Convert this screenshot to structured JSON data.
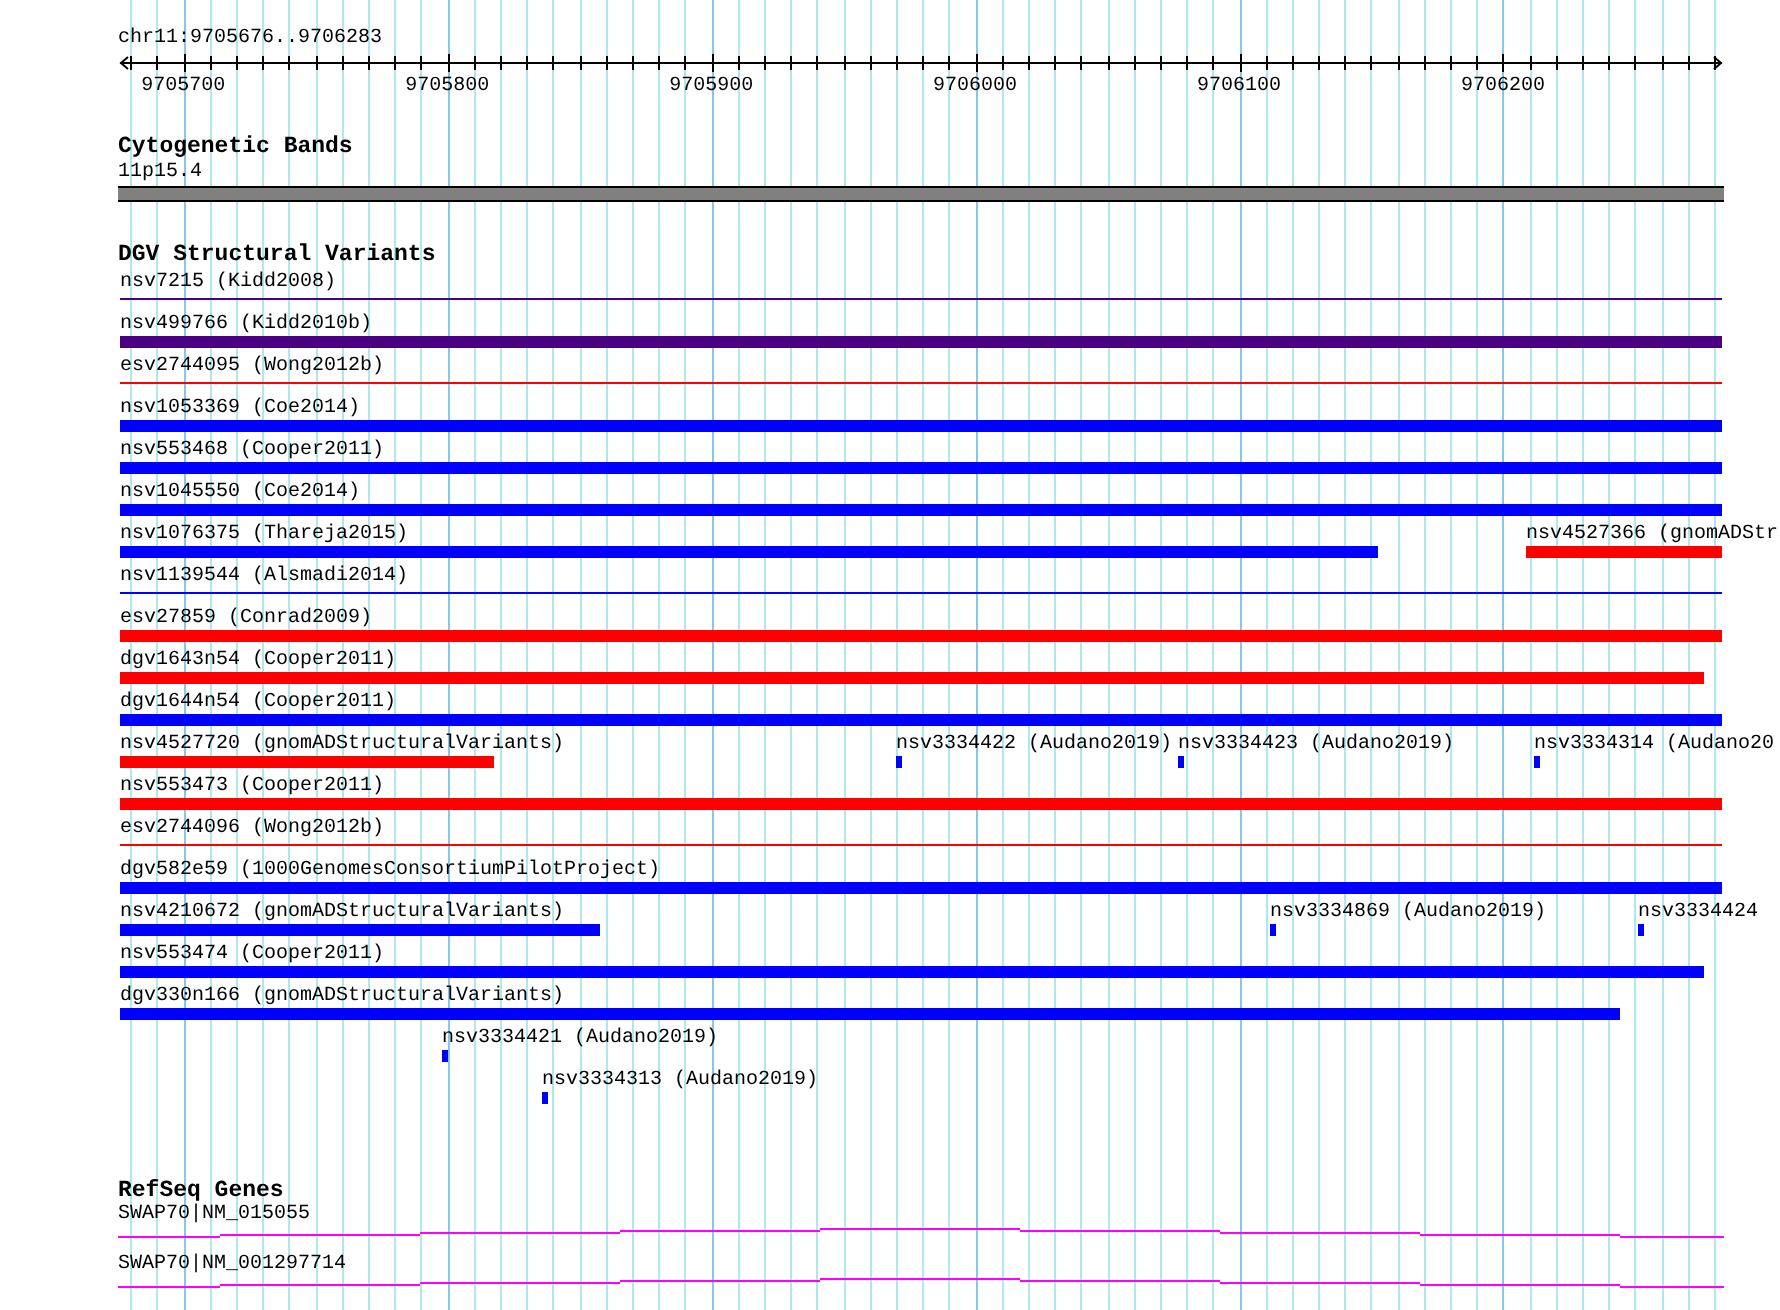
{
  "ruler": {
    "region": "chr11:9705676..9706283",
    "tick_labels": [
      "9705700",
      "9705800",
      "9705900",
      "9706000",
      "9706100",
      "9706200"
    ]
  },
  "cytoband": {
    "title": "Cytogenetic Bands",
    "band": "11p15.4"
  },
  "dgv": {
    "title": "DGV Structural Variants",
    "lanes": [
      {
        "features": [
          {
            "label": "nsv7215 (Kidd2008)",
            "color": "#4b0082",
            "kind": "line"
          }
        ]
      },
      {
        "features": [
          {
            "label": "nsv499766 (Kidd2010b)",
            "color": "#4b0082",
            "kind": "bar"
          }
        ]
      },
      {
        "features": [
          {
            "label": "esv2744095 (Wong2012b)",
            "color": "#ff0000",
            "kind": "line"
          }
        ]
      },
      {
        "features": [
          {
            "label": "nsv1053369 (Coe2014)",
            "color": "#0000ff",
            "kind": "bar"
          }
        ]
      },
      {
        "features": [
          {
            "label": "nsv553468 (Cooper2011)",
            "color": "#0000ff",
            "kind": "bar"
          }
        ]
      },
      {
        "features": [
          {
            "label": "nsv1045550 (Coe2014)",
            "color": "#0000ff",
            "kind": "bar"
          }
        ]
      },
      {
        "features": [
          {
            "label": "nsv1076375 (Thareja2015)",
            "color": "#0000ff",
            "kind": "bar"
          },
          {
            "label": "nsv4527366 (gnomADStr",
            "color": "#ff0000",
            "kind": "bar"
          }
        ]
      },
      {
        "features": [
          {
            "label": "nsv1139544 (Alsmadi2014)",
            "color": "#0000ff",
            "kind": "line"
          }
        ]
      },
      {
        "features": [
          {
            "label": "esv27859 (Conrad2009)",
            "color": "#ff0000",
            "kind": "bar"
          }
        ]
      },
      {
        "features": [
          {
            "label": "dgv1643n54 (Cooper2011)",
            "color": "#ff0000",
            "kind": "bar"
          }
        ]
      },
      {
        "features": [
          {
            "label": "dgv1644n54 (Cooper2011)",
            "color": "#0000ff",
            "kind": "bar"
          }
        ]
      },
      {
        "features": [
          {
            "label": "nsv4527720 (gnomADStructuralVariants)",
            "color": "#ff0000",
            "kind": "bar"
          },
          {
            "label": "nsv3334422 (Audano2019)",
            "color": "#0000ff",
            "kind": "bar"
          },
          {
            "label": "nsv3334423 (Audano2019)",
            "color": "#0000ff",
            "kind": "bar"
          },
          {
            "label": "nsv3334314 (Audano20",
            "color": "#0000ff",
            "kind": "bar"
          }
        ]
      },
      {
        "features": [
          {
            "label": "nsv553473 (Cooper2011)",
            "color": "#ff0000",
            "kind": "bar"
          }
        ]
      },
      {
        "features": [
          {
            "label": "esv2744096 (Wong2012b)",
            "color": "#ff0000",
            "kind": "line"
          }
        ]
      },
      {
        "features": [
          {
            "label": "dgv582e59 (1000GenomesConsortiumPilotProject)",
            "color": "#0000ff",
            "kind": "bar"
          }
        ]
      },
      {
        "features": [
          {
            "label": "nsv4210672 (gnomADStructuralVariants)",
            "color": "#0000ff",
            "kind": "bar"
          },
          {
            "label": "nsv3334869 (Audano2019)",
            "color": "#0000ff",
            "kind": "bar"
          },
          {
            "label": "nsv3334424",
            "color": "#0000ff",
            "kind": "bar"
          }
        ]
      },
      {
        "features": [
          {
            "label": "nsv553474 (Cooper2011)",
            "color": "#0000ff",
            "kind": "bar"
          }
        ]
      },
      {
        "features": [
          {
            "label": "dgv330n166 (gnomADStructuralVariants)",
            "color": "#0000ff",
            "kind": "bar"
          }
        ]
      },
      {
        "features": [
          {
            "label": "nsv3334421 (Audano2019)",
            "color": "#0000ff",
            "kind": "bar"
          }
        ]
      },
      {
        "features": [
          {
            "label": "nsv3334313 (Audano2019)",
            "color": "#0000ff",
            "kind": "bar"
          }
        ]
      }
    ]
  },
  "refseq": {
    "title": "RefSeq Genes",
    "genes": [
      "SWAP70|NM_015055",
      "SWAP70|NM_001297714"
    ]
  }
}
